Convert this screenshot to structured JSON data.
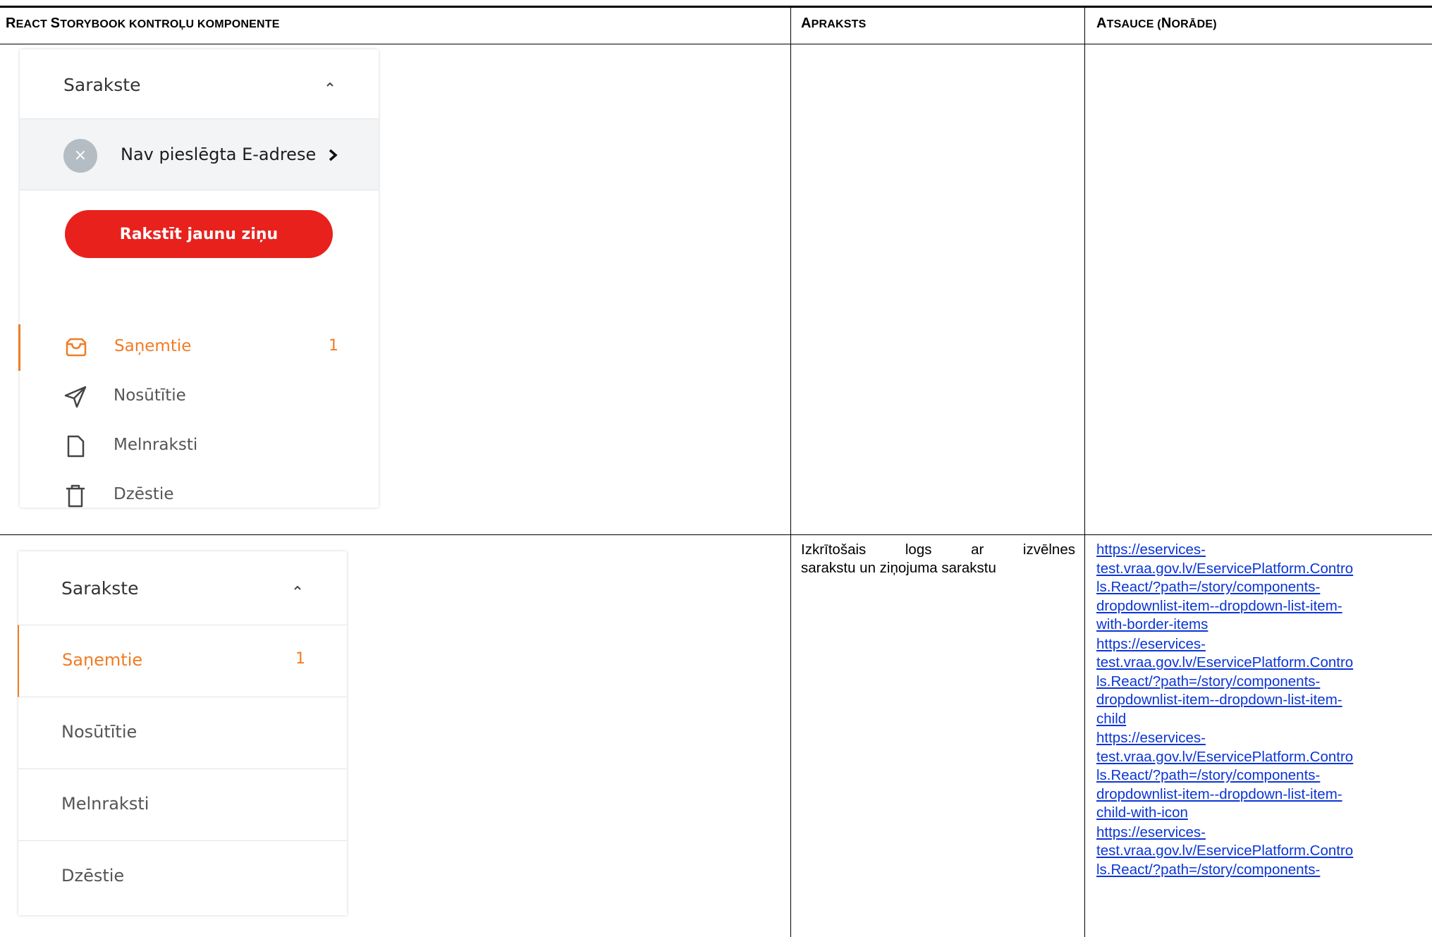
{
  "table": {
    "headers": {
      "col1": {
        "first": "R",
        "first_rest": "eact ",
        "second": "S",
        "second_rest": "torybook kontroļu komponente"
      },
      "col2": {
        "first": "A",
        "rest": "praksts"
      },
      "col3": {
        "first": "A",
        "rest": "tsauce (",
        "second": "N",
        "second_rest": "orāde)"
      }
    }
  },
  "panel1": {
    "title": "Sarakste",
    "status_text": "Nav pieslēgta E-adrese",
    "compose_button": "Rakstīt jaunu ziņu",
    "items": [
      {
        "label": "Saņemtie",
        "count": "1",
        "icon": "inbox-icon"
      },
      {
        "label": "Nosūtītie",
        "count": "",
        "icon": "send-icon"
      },
      {
        "label": "Melnraksti",
        "count": "",
        "icon": "draft-icon"
      },
      {
        "label": "Dzēstie",
        "count": "",
        "icon": "trash-icon"
      }
    ]
  },
  "panel2": {
    "title": "Sarakste",
    "items": [
      {
        "label": "Saņemtie",
        "count": "1"
      },
      {
        "label": "Nosūtītie"
      },
      {
        "label": "Melnraksti"
      },
      {
        "label": "Dzēstie"
      }
    ]
  },
  "description": {
    "line1": "Izkrītošais logs ar izvēlnes",
    "line2": "sarakstu un ziņojuma sarakstu"
  },
  "links": [
    [
      "https://eservices-",
      "test.vraa.gov.lv/EservicePlatform.Contro",
      "ls.React/?path=/story/components-",
      "dropdownlist-item--dropdown-list-item-",
      "with-border-items"
    ],
    [
      "https://eservices-",
      "test.vraa.gov.lv/EservicePlatform.Contro",
      "ls.React/?path=/story/components-",
      "dropdownlist-item--dropdown-list-item-",
      "child"
    ],
    [
      "https://eservices-",
      "test.vraa.gov.lv/EservicePlatform.Contro",
      "ls.React/?path=/story/components-",
      "dropdownlist-item--dropdown-list-item-",
      "child-with-icon"
    ],
    [
      "https://eservices-",
      "test.vraa.gov.lv/EservicePlatform.Contro",
      "ls.React/?path=/story/components-"
    ]
  ],
  "colors": {
    "accent": "#f07c24",
    "button": "#e8211d",
    "link": "#0b35d6"
  }
}
